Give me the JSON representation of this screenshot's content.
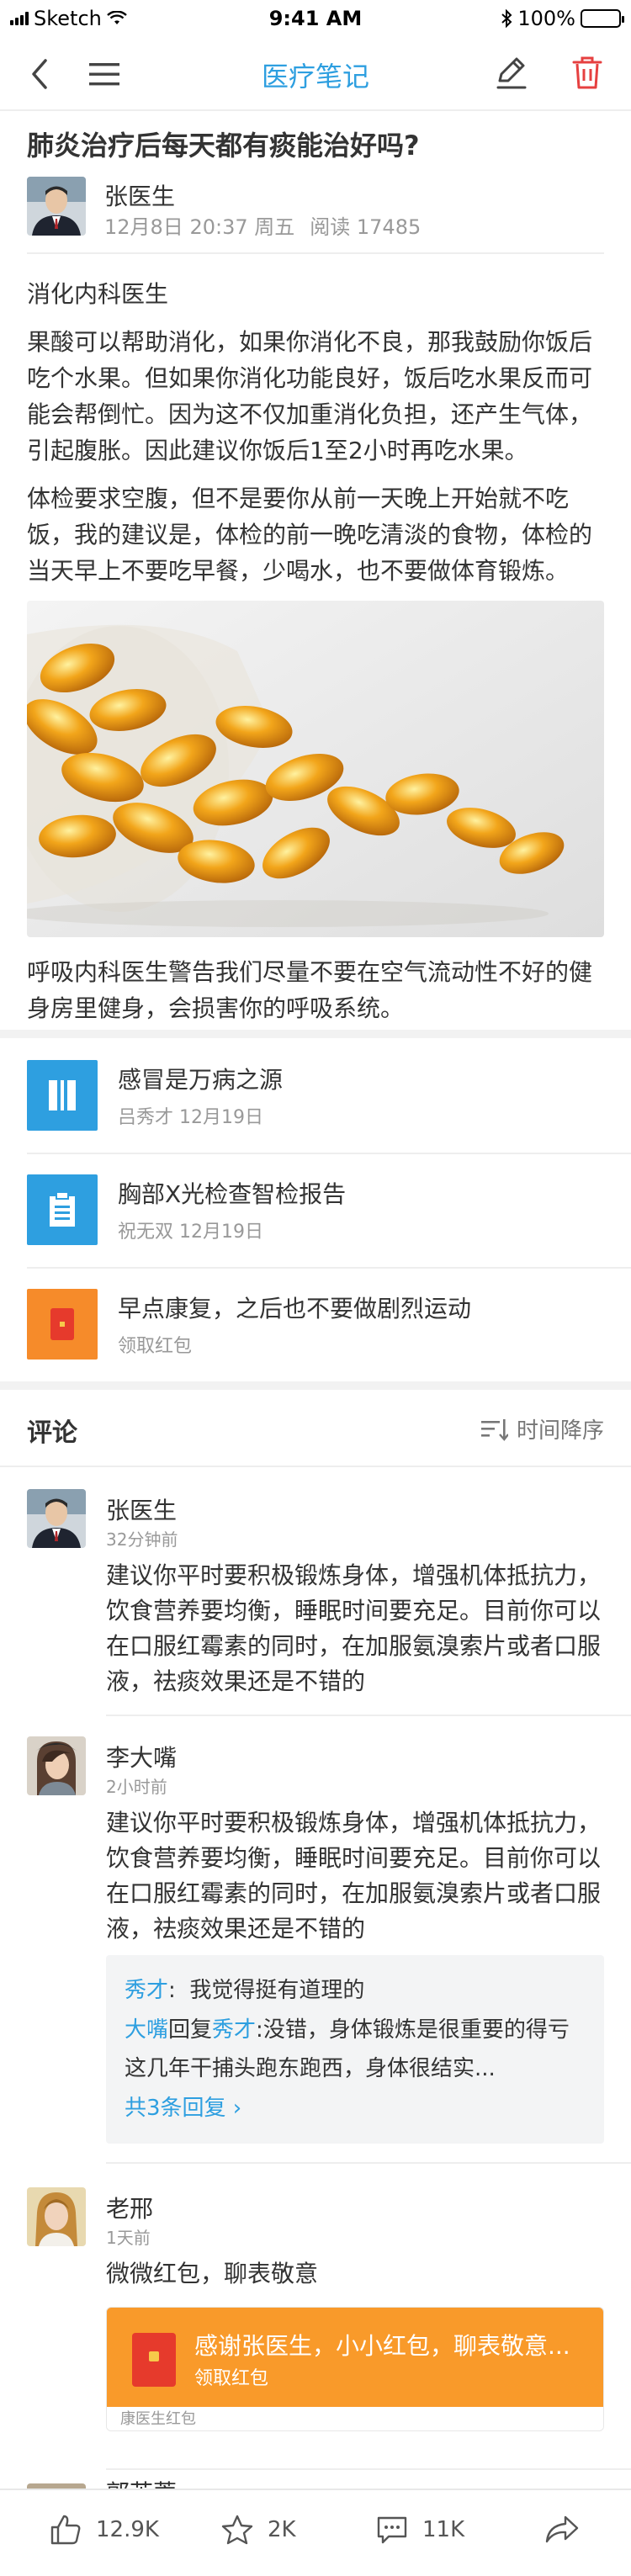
{
  "status_bar": {
    "carrier": "Sketch",
    "time": "9:41 AM",
    "battery": "100%"
  },
  "nav": {
    "title": "医疗笔记"
  },
  "article": {
    "title": "肺炎治疗后每天都有痰能治好吗?",
    "author": "张医生",
    "date": "12月8日",
    "time": "20:37",
    "weekday": "周五",
    "reads": "阅读 17485",
    "paragraphs": [
      "消化内科医生",
      "果酸可以帮助消化，如果你消化不良，那我鼓励你饭后吃个水果。但如果你消化功能良好，饭后吃水果反而可能会帮倒忙。因为这不仅加重消化负担，还产生气体，引起腹胀。因此建议你饭后1至2小时再吃水果。",
      "体检要求空腹，但不是要你从前一天晚上开始就不吃饭，我的建议是，体检的前一晚吃清淡的食物，体检的当天早上不要吃早餐，少喝水，也不要做体育锻炼。"
    ],
    "after_photo": "呼吸内科医生警告我们尽量不要在空气流动性不好的健身房里健身，会损害你的呼吸系统。"
  },
  "attachments": [
    {
      "icon": "book-icon",
      "color": "#2e9fe0",
      "title": "感冒是万病之源",
      "sub": "吕秀才 12月19日"
    },
    {
      "icon": "clipboard-icon",
      "color": "#2e9fe0",
      "title": "胸部X光检查智检报告",
      "sub": "祝无双 12月19日"
    },
    {
      "icon": "red-packet-icon",
      "color": "#f68b2a",
      "title": "早点康复，之后也不要做剧烈运动",
      "sub": "领取红包"
    }
  ],
  "comments_header": {
    "title": "评论",
    "sort": "时间降序"
  },
  "comments": [
    {
      "name": "张医生",
      "time": "32分钟前",
      "text": "建议你平时要积极锻炼身体，增强机体抵抗力，饮食营养要均衡，睡眠时间要充足。目前你可以在口服红霉素的同时，在加服氨溴索片或者口服液，祛痰效果还是不错的"
    },
    {
      "name": "李大嘴",
      "time": "2小时前",
      "text": "建议你平时要积极锻炼身体，增强机体抵抗力，饮食营养要均衡，睡眠时间要充足。目前你可以在口服红霉素的同时，在加服氨溴索片或者口服液，祛痰效果还是不错的",
      "replies": [
        {
          "from": "秀才",
          "text": "我觉得挺有道理的"
        },
        {
          "from": "大嘴",
          "verb": "回复",
          "to": "秀才",
          "text": "没错，身体锻炼是很重要的得亏这几年干捕头跑东跑西，身体很结实..."
        }
      ],
      "more": "共3条回复 ›"
    },
    {
      "name": "老邢",
      "time": "1天前",
      "text": "微微红包，聊表敬意",
      "redpacket": {
        "title": "感谢张医生，小小红包，聊表敬意...",
        "sub": "领取红包",
        "footer": "康医生红包"
      }
    },
    {
      "name": "郭芙蓉"
    }
  ],
  "bottom_bar": {
    "likes": "12.9K",
    "favorites": "2K",
    "comments": "11K"
  }
}
